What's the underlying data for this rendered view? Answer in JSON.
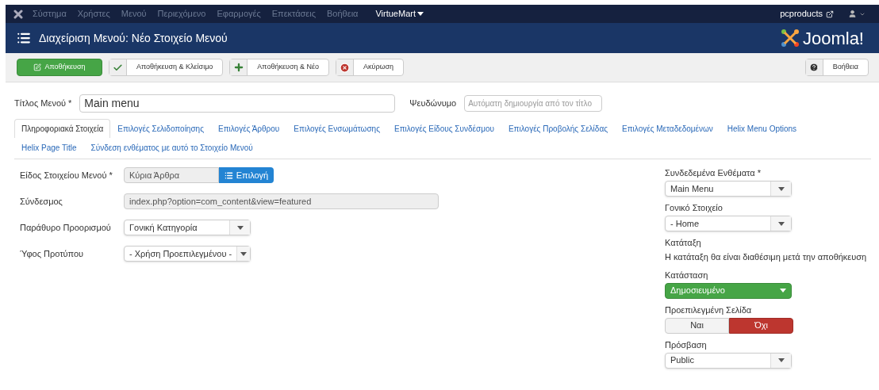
{
  "navbar": {
    "items": [
      "Σύστημα",
      "Χρήστες",
      "Μενού",
      "Περιεχόμενο",
      "Εφαρμογές",
      "Επεκτάσεις",
      "Βοήθεια"
    ],
    "dropdown": "VirtueMart",
    "site": "pcproducts"
  },
  "header": {
    "title": "Διαχείριση Μενού: Νέο Στοιχείο Μενού",
    "logo": "Joomla!"
  },
  "toolbar": [
    {
      "kind": "save",
      "label": "Αποθήκευση"
    },
    {
      "kind": "save-close",
      "label": "Αποθήκευση & Κλείσιμο"
    },
    {
      "kind": "save-new",
      "label": "Αποθήκευση & Νέο"
    },
    {
      "kind": "cancel",
      "label": "Ακύρωση"
    }
  ],
  "help_button": "Βοήθεια",
  "title_field": {
    "label": "Τίτλος Μενού *",
    "value": "Main menu"
  },
  "alias_field": {
    "label": "Ψευδώνυμο",
    "placeholder": "Αυτόματη δημιουργία από τον τίτλο"
  },
  "tabs": [
    {
      "label": "Πληροφοριακά Στοιχεία",
      "selected": true
    },
    {
      "label": "Επιλογές Σελιδοποίησης",
      "selected": false
    },
    {
      "label": "Επιλογές Άρθρου",
      "selected": false
    },
    {
      "label": "Επιλογές Ενσωμάτωσης",
      "selected": false
    },
    {
      "label": "Επιλογές Είδους Συνδέσμου",
      "selected": false
    },
    {
      "label": "Επιλογές Προβολής Σελίδας",
      "selected": false
    },
    {
      "label": "Επιλογές Μεταδεδομένων",
      "selected": false
    },
    {
      "label": "Helix Menu Options",
      "selected": false
    },
    {
      "label": "Helix Page Title",
      "selected": false
    },
    {
      "label": "Σύνδεση ενθέματος με αυτό το Στοιχείο Μενού",
      "selected": false
    }
  ],
  "left_fields": [
    {
      "kind": "picker",
      "label": "Είδος Στοιχείου Μενού *",
      "value": "Κύρια Άρθρα",
      "button": "Επιλογή"
    },
    {
      "kind": "readonly",
      "label": "Σύνδεσμος",
      "value": "index.php?option=com_content&view=featured"
    },
    {
      "kind": "select",
      "label": "Παράθυρο Προορισμού",
      "value": "Γονική Κατηγορία"
    },
    {
      "kind": "select",
      "label": "Ύφος Προτύπου",
      "value": "- Χρήση Προεπιλεγμένου -"
    }
  ],
  "right_fields": [
    {
      "kind": "select",
      "label": "Συνδεδεμένα Ενθέματα *",
      "value": "Main Menu"
    },
    {
      "kind": "select",
      "label": "Γονικό Στοιχείο",
      "value": "- Home"
    },
    {
      "kind": "note",
      "label": "Κατάταξη",
      "value": "Η κατάταξη θα είναι διαθέσιμη μετά την αποθήκευση"
    },
    {
      "kind": "status",
      "label": "Κατάσταση",
      "value": "Δημοσιευμένο"
    },
    {
      "kind": "toggle",
      "label": "Προεπιλεγμένη Σελίδα",
      "options": [
        {
          "label": "Ναι",
          "selected": false
        },
        {
          "label": "Όχι",
          "selected": true
        }
      ]
    },
    {
      "kind": "select",
      "label": "Πρόσβαση",
      "value": "Public"
    }
  ]
}
